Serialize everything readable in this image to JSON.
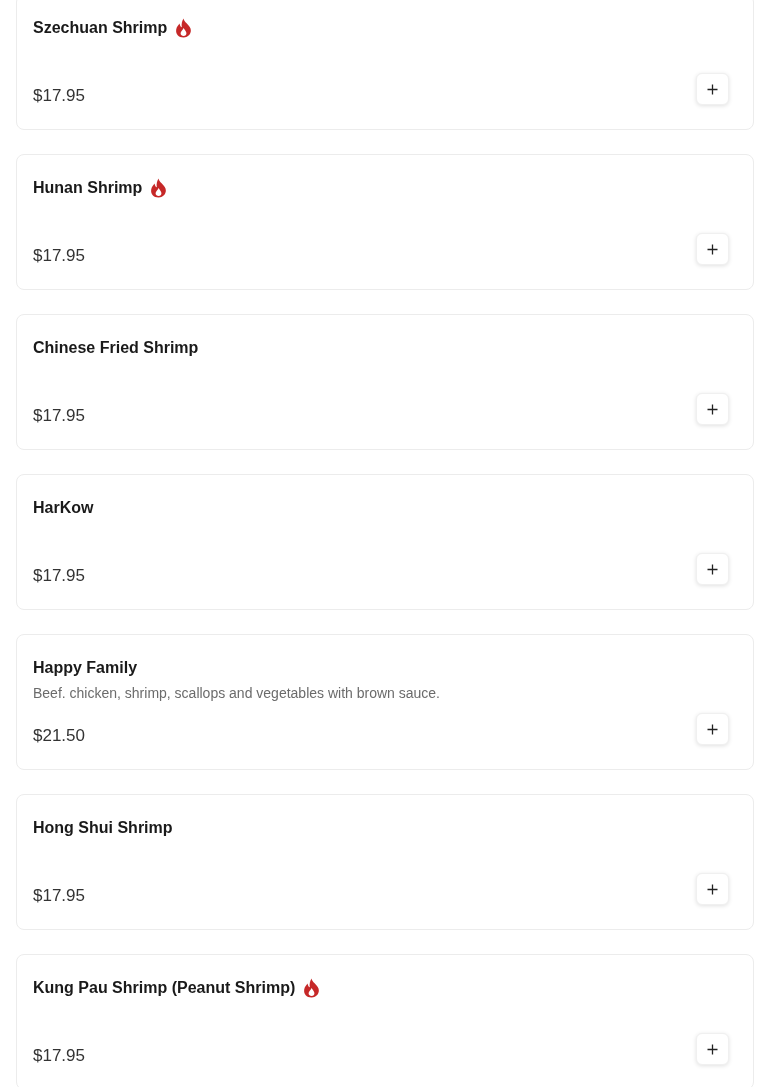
{
  "items": [
    {
      "name": "Szechuan Shrimp",
      "spicy": true,
      "price": "$17.95"
    },
    {
      "name": "Hunan Shrimp",
      "spicy": true,
      "price": "$17.95"
    },
    {
      "name": "Chinese Fried Shrimp",
      "spicy": false,
      "price": "$17.95"
    },
    {
      "name": "HarKow",
      "spicy": false,
      "price": "$17.95"
    },
    {
      "name": "Happy Family",
      "spicy": false,
      "description": "Beef. chicken, shrimp, scallops and vegetables with brown sauce.",
      "price": "$21.50"
    },
    {
      "name": "Hong Shui Shrimp",
      "spicy": false,
      "price": "$17.95"
    },
    {
      "name": "Kung Pau Shrimp (Peanut Shrimp)",
      "spicy": true,
      "price": "$17.95"
    }
  ]
}
